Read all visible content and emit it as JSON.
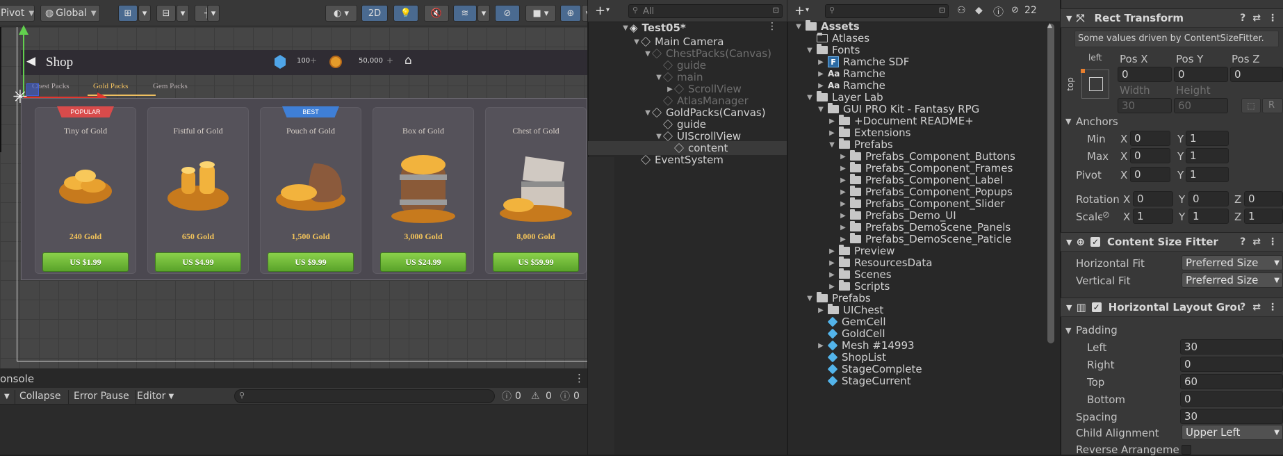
{
  "scene": {
    "toolbar": {
      "pivot": "Pivot",
      "global": "Global",
      "mode_2d": "2D"
    },
    "shop": {
      "title": "Shop",
      "gems": "100",
      "coins": "50,000",
      "tabs": [
        "Chest Packs",
        "Gold Packs",
        "Gem Packs"
      ],
      "active_tab": "Gold Packs",
      "cards": [
        {
          "name": "Tiny of Gold",
          "gold": "240 Gold",
          "price": "US $1.99",
          "ribbon": "POPULAR",
          "ribbon_color": "#d84b4b"
        },
        {
          "name": "Fistful of Gold",
          "gold": "650 Gold",
          "price": "US $4.99",
          "ribbon": "",
          "ribbon_color": ""
        },
        {
          "name": "Pouch of Gold",
          "gold": "1,500 Gold",
          "price": "US $9.99",
          "ribbon": "BEST",
          "ribbon_color": "#3f7fd6"
        },
        {
          "name": "Box of Gold",
          "gold": "3,000 Gold",
          "price": "US $24.99",
          "ribbon": "",
          "ribbon_color": ""
        },
        {
          "name": "Chest of Gold",
          "gold": "8,000 Gold",
          "price": "US $59.99",
          "ribbon": "",
          "ribbon_color": ""
        }
      ]
    }
  },
  "console": {
    "tab": "onsole",
    "collapse": "Collapse",
    "error_pause": "Error Pause",
    "editor": "Editor",
    "info_count": "0",
    "warn_count": "0",
    "error_count": "0"
  },
  "hierarchy": {
    "search_placeholder": "All",
    "scene_name": "Test05*",
    "items": [
      {
        "label": "Main Camera",
        "indent": 1,
        "arrow": "▼",
        "dim": false
      },
      {
        "label": "ChestPacks(Canvas)",
        "indent": 2,
        "arrow": "▼",
        "dim": true
      },
      {
        "label": "guide",
        "indent": 3,
        "arrow": "",
        "dim": true
      },
      {
        "label": "main",
        "indent": 3,
        "arrow": "▼",
        "dim": true
      },
      {
        "label": "ScrollView",
        "indent": 4,
        "arrow": "▶",
        "dim": true
      },
      {
        "label": "AtlasManager",
        "indent": 3,
        "arrow": "",
        "dim": true
      },
      {
        "label": "GoldPacks(Canvas)",
        "indent": 2,
        "arrow": "▼",
        "dim": false
      },
      {
        "label": "guide",
        "indent": 3,
        "arrow": "",
        "dim": false
      },
      {
        "label": "UIScrollView",
        "indent": 3,
        "arrow": "▼",
        "dim": false
      },
      {
        "label": "content",
        "indent": 4,
        "arrow": "",
        "dim": false
      },
      {
        "label": "EventSystem",
        "indent": 1,
        "arrow": "",
        "dim": false
      }
    ]
  },
  "project": {
    "hidden_count": "22",
    "items": [
      {
        "label": "Assets",
        "indent": 0,
        "arrow": "▼",
        "icon": "folder",
        "bold": true
      },
      {
        "label": "Atlases",
        "indent": 1,
        "arrow": "",
        "icon": "folder-empty"
      },
      {
        "label": "Fonts",
        "indent": 1,
        "arrow": "▼",
        "icon": "folder"
      },
      {
        "label": "Ramche SDF",
        "indent": 2,
        "arrow": "▶",
        "icon": "font-asset"
      },
      {
        "label": "Ramche",
        "indent": 2,
        "arrow": "▶",
        "icon": "font"
      },
      {
        "label": "Ramche",
        "indent": 2,
        "arrow": "▶",
        "icon": "font"
      },
      {
        "label": "Layer Lab",
        "indent": 1,
        "arrow": "▼",
        "icon": "folder"
      },
      {
        "label": "GUI PRO Kit - Fantasy RPG",
        "indent": 2,
        "arrow": "▼",
        "icon": "folder"
      },
      {
        "label": "+Document README+",
        "indent": 3,
        "arrow": "▶",
        "icon": "folder"
      },
      {
        "label": "Extensions",
        "indent": 3,
        "arrow": "▶",
        "icon": "folder"
      },
      {
        "label": "Prefabs",
        "indent": 3,
        "arrow": "▼",
        "icon": "folder-open"
      },
      {
        "label": "Prefabs_Component_Buttons",
        "indent": 4,
        "arrow": "▶",
        "icon": "folder"
      },
      {
        "label": "Prefabs_Component_Frames",
        "indent": 4,
        "arrow": "▶",
        "icon": "folder"
      },
      {
        "label": "Prefabs_Component_Label",
        "indent": 4,
        "arrow": "▶",
        "icon": "folder"
      },
      {
        "label": "Prefabs_Component_Popups",
        "indent": 4,
        "arrow": "▶",
        "icon": "folder"
      },
      {
        "label": "Prefabs_Component_Slider",
        "indent": 4,
        "arrow": "▶",
        "icon": "folder"
      },
      {
        "label": "Prefabs_Demo_UI",
        "indent": 4,
        "arrow": "▶",
        "icon": "folder"
      },
      {
        "label": "Prefabs_DemoScene_Panels",
        "indent": 4,
        "arrow": "▶",
        "icon": "folder"
      },
      {
        "label": "Prefabs_DemoScene_Paticle",
        "indent": 4,
        "arrow": "▶",
        "icon": "folder"
      },
      {
        "label": "Preview",
        "indent": 3,
        "arrow": "▶",
        "icon": "folder"
      },
      {
        "label": "ResourcesData",
        "indent": 3,
        "arrow": "▶",
        "icon": "folder"
      },
      {
        "label": "Scenes",
        "indent": 3,
        "arrow": "▶",
        "icon": "folder"
      },
      {
        "label": "Scripts",
        "indent": 3,
        "arrow": "▶",
        "icon": "folder"
      },
      {
        "label": "Prefabs",
        "indent": 1,
        "arrow": "▼",
        "icon": "folder"
      },
      {
        "label": "UIChest",
        "indent": 2,
        "arrow": "▶",
        "icon": "folder"
      },
      {
        "label": "GemCell",
        "indent": 2,
        "arrow": "",
        "icon": "prefab"
      },
      {
        "label": "GoldCell",
        "indent": 2,
        "arrow": "",
        "icon": "prefab"
      },
      {
        "label": "Mesh #14993",
        "indent": 2,
        "arrow": "▶",
        "icon": "prefab"
      },
      {
        "label": "ShopList",
        "indent": 2,
        "arrow": "",
        "icon": "prefab"
      },
      {
        "label": "StageComplete",
        "indent": 2,
        "arrow": "",
        "icon": "prefab"
      },
      {
        "label": "StageCurrent",
        "indent": 2,
        "arrow": "",
        "icon": "prefab"
      }
    ]
  },
  "inspector": {
    "rect_transform": {
      "title": "Rect Transform",
      "note": "Some values driven by ContentSizeFitter.",
      "anchor_h": "left",
      "anchor_v": "top",
      "pos_x_label": "Pos X",
      "pos_y_label": "Pos Y",
      "pos_z_label": "Pos Z",
      "pos_x": "0",
      "pos_y": "0",
      "pos_z": "0",
      "width_label": "Width",
      "height_label": "Height",
      "width": "30",
      "height": "60",
      "anchors_label": "Anchors",
      "min_label": "Min",
      "max_label": "Max",
      "pivot_label": "Pivot",
      "min_x": "0",
      "min_y": "1",
      "max_x": "0",
      "max_y": "1",
      "pivot_x": "0",
      "pivot_y": "1",
      "rotation_label": "Rotation",
      "scale_label": "Scale",
      "rot_x": "0",
      "rot_y": "0",
      "rot_z": "0",
      "scale_x": "1",
      "scale_y": "1",
      "scale_z": "1",
      "x": "X",
      "y": "Y",
      "z": "Z",
      "r_btn": "R"
    },
    "content_size_fitter": {
      "title": "Content Size Fitter",
      "h_fit_label": "Horizontal Fit",
      "h_fit": "Preferred Size",
      "v_fit_label": "Vertical Fit",
      "v_fit": "Preferred Size"
    },
    "layout_group": {
      "title": "Horizontal Layout Group",
      "padding_label": "Padding",
      "left_label": "Left",
      "left": "30",
      "right_label": "Right",
      "right": "0",
      "top_label": "Top",
      "top": "60",
      "bottom_label": "Bottom",
      "bottom": "0",
      "spacing_label": "Spacing",
      "spacing": "30",
      "child_align_label": "Child Alignment",
      "child_align": "Upper Left",
      "reverse_label": "Reverse Arrangement"
    }
  }
}
